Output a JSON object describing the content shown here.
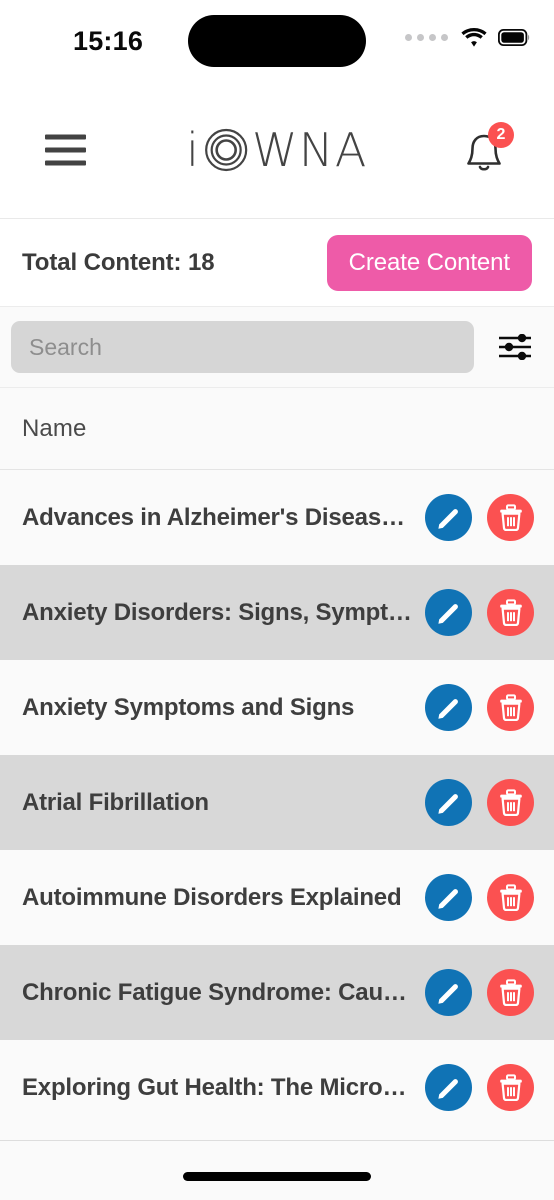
{
  "status_bar": {
    "time": "15:16",
    "signal_icon": "signal-dots-icon",
    "wifi_icon": "wifi-icon",
    "battery_icon": "battery-full-icon"
  },
  "header": {
    "menu_icon": "hamburger-menu-icon",
    "logo_prefix": "i",
    "logo_mark": "ring-o-icon",
    "logo_suffix": "WNA",
    "logo_full": "iOWNA",
    "bell_icon": "notification-bell-icon",
    "bell_badge": "2"
  },
  "toolbar": {
    "total_label": "Total Content: 18",
    "create_label": "Create Content"
  },
  "search": {
    "value": "",
    "placeholder": "Search",
    "filter_icon": "filter-sliders-icon"
  },
  "table": {
    "columns": [
      "Name"
    ],
    "rows": [
      {
        "name": "Advances in Alzheimer's Disease…",
        "edit_icon": "pencil-edit-icon",
        "delete_icon": "trash-delete-icon"
      },
      {
        "name": "Anxiety Disorders: Signs, Sympt…",
        "edit_icon": "pencil-edit-icon",
        "delete_icon": "trash-delete-icon"
      },
      {
        "name": "Anxiety Symptoms and Signs",
        "edit_icon": "pencil-edit-icon",
        "delete_icon": "trash-delete-icon"
      },
      {
        "name": "Atrial Fibrillation",
        "edit_icon": "pencil-edit-icon",
        "delete_icon": "trash-delete-icon"
      },
      {
        "name": "Autoimmune Disorders Explained",
        "edit_icon": "pencil-edit-icon",
        "delete_icon": "trash-delete-icon"
      },
      {
        "name": "Chronic Fatigue Syndrome: Caus…",
        "edit_icon": "pencil-edit-icon",
        "delete_icon": "trash-delete-icon"
      },
      {
        "name": "Exploring Gut Health: The Micro…",
        "edit_icon": "pencil-edit-icon",
        "delete_icon": "trash-delete-icon"
      }
    ]
  },
  "colors": {
    "accent_pink": "#ee5ba8",
    "edit_blue": "#1073b5",
    "delete_red": "#fb5151",
    "badge_red": "#fb5151",
    "row_alt": "#d8d8d8",
    "row_base": "#fafafa",
    "search_field": "#d6d6d6",
    "text_dark": "#3e3e3e"
  }
}
